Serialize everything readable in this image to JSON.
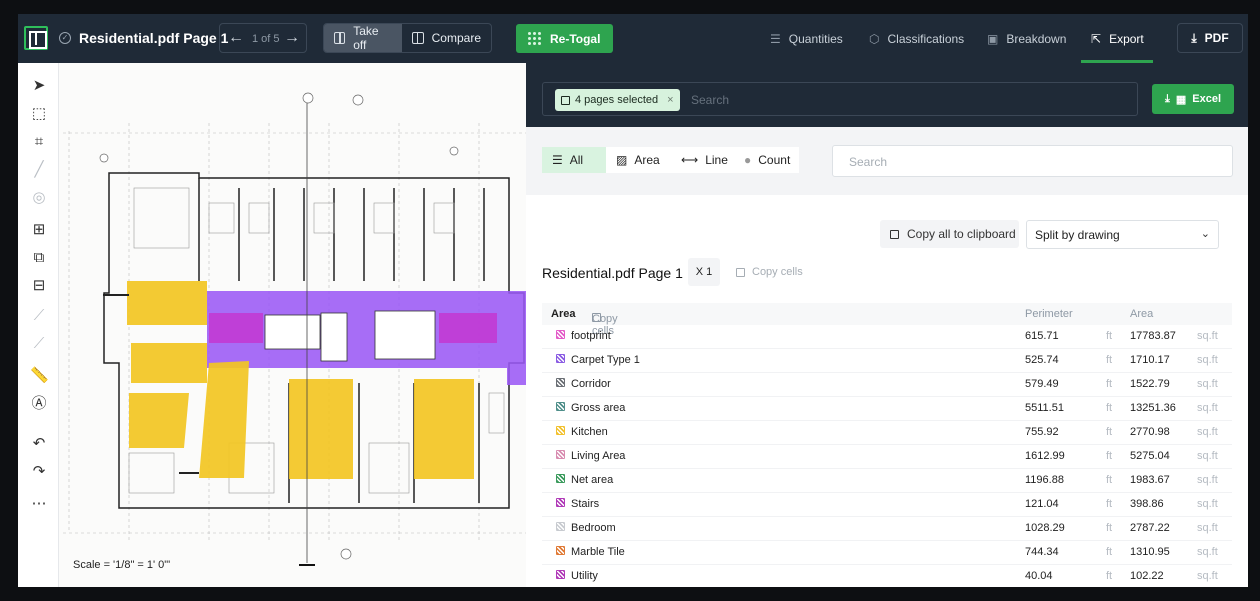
{
  "header": {
    "doc_title": "Residential.pdf Page 1",
    "page_indicator": "1 of 5",
    "takeoff_label": "Take off",
    "compare_label": "Compare",
    "retogal_label": "Re-Togal",
    "nav": [
      "Quantities",
      "Classifications",
      "Breakdown",
      "Export"
    ],
    "pdf_label": "PDF",
    "active_nav": "Export",
    "accent": "#2ea44f"
  },
  "drawing": {
    "scale_label": "Scale = '1/8\" = 1' 0\"'"
  },
  "export": {
    "pages_chip": "4 pages selected",
    "search_placeholder": "Search",
    "excel_label": "Excel",
    "filters": [
      "All",
      "Area",
      "Line",
      "Count"
    ],
    "filter_search_placeholder": "Search",
    "copy_all_label": "Copy all to clipboard",
    "split_label": "Split by drawing",
    "section_title": "Residential.pdf Page 1",
    "count_badge": "X 1",
    "copy_cells_label": "Copy cells",
    "table_headers": {
      "name": "Area",
      "copy": "Copy cells",
      "perimeter": "Perimeter",
      "area": "Area"
    },
    "rows": [
      {
        "name": "footprint",
        "perimeter": "615.71",
        "p_unit": "ft",
        "area": "17783.87",
        "a_unit": "sq.ft",
        "color": "#e35bc8"
      },
      {
        "name": "Carpet Type 1",
        "perimeter": "525.74",
        "p_unit": "ft",
        "area": "1710.17",
        "a_unit": "sq.ft",
        "color": "#8a5be3"
      },
      {
        "name": "Corridor",
        "perimeter": "579.49",
        "p_unit": "ft",
        "area": "1522.79",
        "a_unit": "sq.ft",
        "color": "#6b6f75"
      },
      {
        "name": "Gross area",
        "perimeter": "5511.51",
        "p_unit": "ft",
        "area": "13251.36",
        "a_unit": "sq.ft",
        "color": "#4f8f8a"
      },
      {
        "name": "Kitchen",
        "perimeter": "755.92",
        "p_unit": "ft",
        "area": "2770.98",
        "a_unit": "sq.ft",
        "color": "#f2c12e"
      },
      {
        "name": "Living Area",
        "perimeter": "1612.99",
        "p_unit": "ft",
        "area": "5275.04",
        "a_unit": "sq.ft",
        "color": "#d88cb0"
      },
      {
        "name": "Net area",
        "perimeter": "1196.88",
        "p_unit": "ft",
        "area": "1983.67",
        "a_unit": "sq.ft",
        "color": "#3a9a5c"
      },
      {
        "name": "Stairs",
        "perimeter": "121.04",
        "p_unit": "ft",
        "area": "398.86",
        "a_unit": "sq.ft",
        "color": "#b03ab8"
      },
      {
        "name": "Bedroom",
        "perimeter": "1028.29",
        "p_unit": "ft",
        "area": "2787.22",
        "a_unit": "sq.ft",
        "color": "#c8cbd0"
      },
      {
        "name": "Marble Tile",
        "perimeter": "744.34",
        "p_unit": "ft",
        "area": "1310.95",
        "a_unit": "sq.ft",
        "color": "#e07a35"
      },
      {
        "name": "Utility",
        "perimeter": "40.04",
        "p_unit": "ft",
        "area": "102.22",
        "a_unit": "sq.ft",
        "color": "#b03ab8"
      }
    ]
  }
}
